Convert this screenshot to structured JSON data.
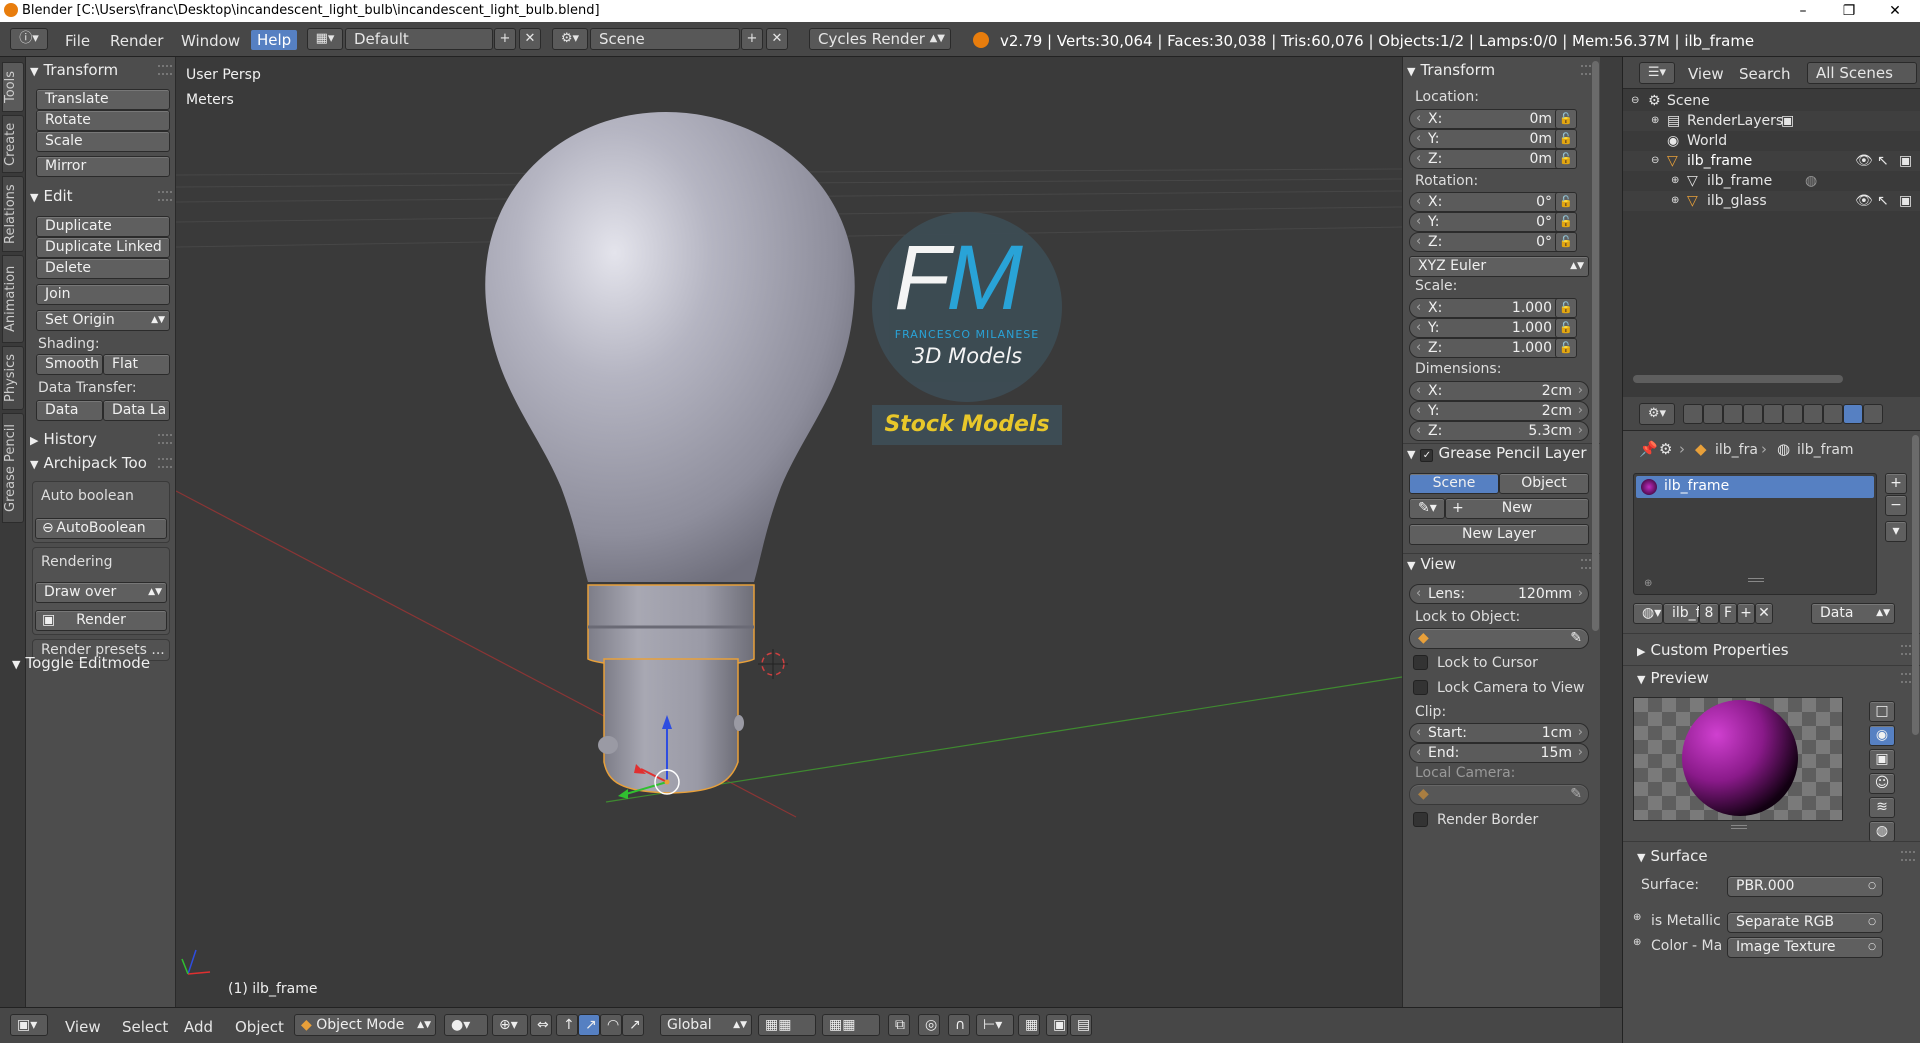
{
  "titlebar": {
    "title": "Blender [C:\\Users\\franc\\Desktop\\incandescent_light_bulb\\incandescent_light_bulb.blend]"
  },
  "menu": {
    "file": "File",
    "render": "Render",
    "window": "Window",
    "help": "Help"
  },
  "screen_layout": "Default",
  "scene_name": "Scene",
  "render_engine": "Cycles Render",
  "stats": "v2.79 | Verts:30,064 | Faces:30,038 | Tris:60,076 | Objects:1/2 | Lamps:0/0 | Mem:56.37M | ilb_frame",
  "tabs": [
    "Tools",
    "Create",
    "Relations",
    "Animation",
    "Physics",
    "Grease Pencil"
  ],
  "toolshelf": {
    "transform_title": "Transform",
    "translate": "Translate",
    "rotate": "Rotate",
    "scale": "Scale",
    "mirror": "Mirror",
    "edit_title": "Edit",
    "duplicate": "Duplicate",
    "duplicate_linked": "Duplicate Linked",
    "delete": "Delete",
    "join": "Join",
    "set_origin": "Set Origin",
    "shading_label": "Shading:",
    "smooth": "Smooth",
    "flat": "Flat",
    "data_transfer_label": "Data Transfer:",
    "data": "Data",
    "data_layout": "Data La",
    "history_title": "History",
    "archipack_title": "Archipack Too",
    "auto_boolean_label": "Auto boolean",
    "autoboolean_btn": "AutoBoolean",
    "rendering_label": "Rendering",
    "draw_over": "Draw over",
    "render_btn": "Render",
    "render_presets": "Render presets ...",
    "toggle_editmode": "Toggle Editmode"
  },
  "viewport": {
    "view_name": "User Persp",
    "units": "Meters",
    "object_label": "(1) ilb_frame",
    "logo_initials_f": "F",
    "logo_initials_m": "M",
    "logo_name": "FRANCESCO MILANESE",
    "logo_sub": "3D Models",
    "logo_banner": "Stock Models"
  },
  "npanel": {
    "transform_title": "Transform",
    "location_label": "Location:",
    "location": [
      {
        "k": "X:",
        "v": "0m"
      },
      {
        "k": "Y:",
        "v": "0m"
      },
      {
        "k": "Z:",
        "v": "0m"
      }
    ],
    "rotation_label": "Rotation:",
    "rotation": [
      {
        "k": "X:",
        "v": "0°"
      },
      {
        "k": "Y:",
        "v": "0°"
      },
      {
        "k": "Z:",
        "v": "0°"
      }
    ],
    "rotation_mode": "XYZ Euler",
    "scale_label": "Scale:",
    "scale": [
      {
        "k": "X:",
        "v": "1.000"
      },
      {
        "k": "Y:",
        "v": "1.000"
      },
      {
        "k": "Z:",
        "v": "1.000"
      }
    ],
    "dimensions_label": "Dimensions:",
    "dimensions": [
      {
        "k": "X:",
        "v": "2cm"
      },
      {
        "k": "Y:",
        "v": "2cm"
      },
      {
        "k": "Z:",
        "v": "5.3cm"
      }
    ],
    "grease_title": "Grease Pencil Layer",
    "scene_tab": "Scene",
    "object_tab": "Object",
    "new_btn": "New",
    "new_layer_btn": "New Layer",
    "view_title": "View",
    "lens_label": "Lens:",
    "lens_value": "120mm",
    "lock_to_object_label": "Lock to Object:",
    "lock_to_cursor": "Lock to Cursor",
    "lock_camera": "Lock Camera to View",
    "clip_label": "Clip:",
    "clip_start_label": "Start:",
    "clip_start": "1cm",
    "clip_end_label": "End:",
    "clip_end": "15m",
    "local_camera_label": "Local Camera:",
    "render_border": "Render Border"
  },
  "outliner": {
    "view_menu": "View",
    "search_menu": "Search",
    "display_mode": "All Scenes",
    "items": [
      "Scene",
      "RenderLayers",
      "World",
      "ilb_frame",
      "ilb_frame",
      "ilb_glass"
    ]
  },
  "props": {
    "breadcrumb_obj": "ilb_fra",
    "breadcrumb_mat": "ilb_fram",
    "material_slot": "ilb_frame",
    "mat_name": "ilb_fr",
    "mat_users": "8",
    "mat_fake": "F",
    "link_mode": "Data",
    "custom_properties": "Custom Properties",
    "preview_title": "Preview",
    "surface_title": "Surface",
    "surface_label": "Surface:",
    "surface_value": "PBR.000",
    "is_metallic_label": "is Metallic",
    "is_metallic_value": "Separate RGB",
    "color_label": "Color - Ma",
    "color_value": "Image Texture"
  },
  "bottombar": {
    "view": "View",
    "select": "Select",
    "add": "Add",
    "object": "Object",
    "mode": "Object Mode",
    "orientation": "Global"
  },
  "colors": {
    "accent": "#5680c2",
    "selection_orange": "#e8a03a",
    "logo_cyan": "#29a9e0",
    "logo_yellow": "#e8c72a"
  }
}
